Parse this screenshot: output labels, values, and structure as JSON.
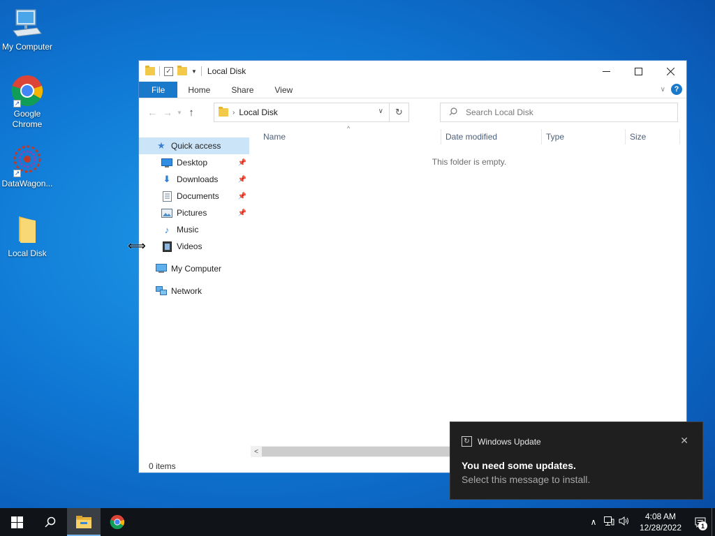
{
  "desktop": {
    "icons": [
      {
        "label": "My Computer"
      },
      {
        "label": "Google Chrome"
      },
      {
        "label": "DataWagon..."
      },
      {
        "label": "Local Disk"
      }
    ]
  },
  "window": {
    "title": "Local Disk",
    "ribbon_tabs": [
      "File",
      "Home",
      "Share",
      "View"
    ],
    "address": {
      "current": "Local Disk"
    },
    "search": {
      "placeholder": "Search Local Disk"
    },
    "nav": {
      "quick_access": "Quick access",
      "items": [
        "Desktop",
        "Downloads",
        "Documents",
        "Pictures",
        "Music",
        "Videos"
      ],
      "my_computer": "My Computer",
      "network": "Network"
    },
    "columns": [
      "Name",
      "Date modified",
      "Type",
      "Size"
    ],
    "empty_message": "This folder is empty.",
    "status": "0 items"
  },
  "toast": {
    "app": "Windows Update",
    "title": "You need some updates.",
    "body": "Select this message to install."
  },
  "taskbar": {
    "time": "4:08 AM",
    "date": "12/28/2022",
    "notification_count": "1"
  },
  "colors": {
    "accent": "#1979ca",
    "selection": "#cce4f7",
    "toast_bg": "#1f1f1f",
    "taskbar_bg": "#101418"
  }
}
